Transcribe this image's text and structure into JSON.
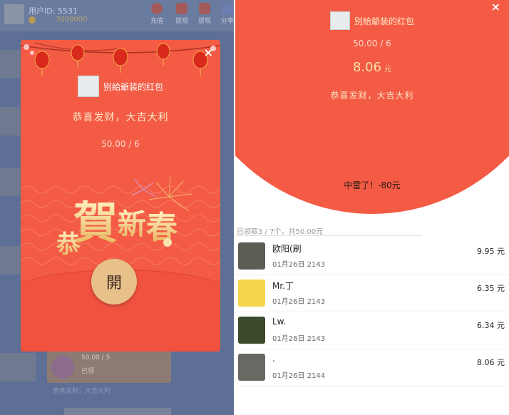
{
  "background_app": {
    "user_id": "用户ID: 5531",
    "balance": "3000000",
    "actions": [
      "充值",
      "提现",
      "提现",
      "分享"
    ],
    "message_amount": "50.00 / 5",
    "message_label": "已领",
    "message_caption": "恭喜发财，大吉大利"
  },
  "modal": {
    "sender_name": "别給爺装的红包",
    "greeting": "恭喜发财，大吉大利",
    "amount": "50.00 / 6",
    "open_label": "開",
    "close_label": "×",
    "calligraphy_chars": [
      "恭",
      "賀",
      "新",
      "春"
    ]
  },
  "detail": {
    "close_label": "×",
    "sender_name": "别給爺装的红包",
    "total": "50.00 / 6",
    "received_amount": "8.06",
    "received_unit": "元",
    "greeting": "恭喜发财，大吉大利",
    "mine_result": "中雷了！-80元",
    "summary": "已领取3 / 7个，共50.00元",
    "records": [
      {
        "name": "欧阳(刷",
        "time": "01月26日  2143",
        "amount": "9.95 元"
      },
      {
        "name": "Mr.丁",
        "time": "01月26日  2143",
        "amount": "6.35 元"
      },
      {
        "name": "Lw.",
        "time": "01月26日  2143",
        "amount": "6.34 元"
      },
      {
        "name": ".",
        "time": "01月26日  2144",
        "amount": "8.06 元"
      }
    ]
  },
  "colors": {
    "packet_red": "#f35b45",
    "gold": "#e8c18a",
    "overlay": "#5e6f96"
  }
}
